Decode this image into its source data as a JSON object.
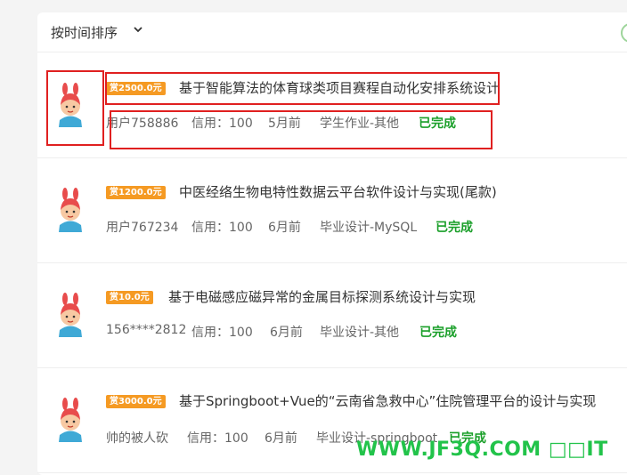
{
  "sort": {
    "label": "按时间排序"
  },
  "projects": [
    {
      "bounty": "赏2500.0元",
      "title": "基于智能算法的体育球类项目赛程自动化安排系统设计",
      "user": "用户758886",
      "credit": "信用：100",
      "time": "5月前",
      "category": "学生作业-其他",
      "status": "已完成"
    },
    {
      "bounty": "赏1200.0元",
      "title": "中医经络生物电特性数据云平台软件设计与实现(尾款)",
      "user": "用户767234",
      "credit": "信用：100",
      "time": "6月前",
      "category": "毕业设计-MySQL",
      "status": "已完成"
    },
    {
      "bounty": "赏10.0元",
      "title": "基于电磁感应磁异常的金属目标探测系统设计与实现",
      "user": "156****2812",
      "credit": "信用：100",
      "time": "6月前",
      "category": "毕业设计-其他",
      "status": "已完成"
    },
    {
      "bounty": "赏3000.0元",
      "title": "基于Springboot+Vue的“云南省急救中心”住院管理平台的设计与实现",
      "user": "帅的被人砍",
      "credit": "信用：100",
      "time": "6月前",
      "category": "毕业设计-springboot",
      "status": "已完成"
    }
  ],
  "watermark": "WWW.JF3Q.COM □□IT",
  "colors": {
    "status": "#1a9f29",
    "bounty": "#f59a23",
    "highlight": "#e02020"
  }
}
